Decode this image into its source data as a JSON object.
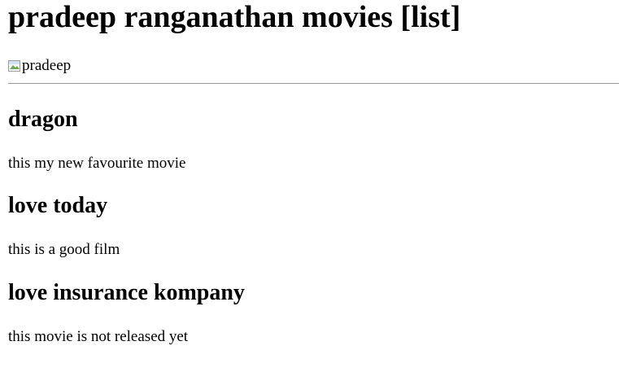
{
  "page": {
    "title": "pradeep ranganathan movies [list]"
  },
  "image": {
    "alt": "pradeep",
    "icon": "broken-image-icon"
  },
  "movies": [
    {
      "title": "dragon",
      "description": "this my new favourite movie"
    },
    {
      "title": "love today",
      "description": "this is a good film"
    },
    {
      "title": "love insurance kompany",
      "description": "this movie is not released yet"
    }
  ]
}
